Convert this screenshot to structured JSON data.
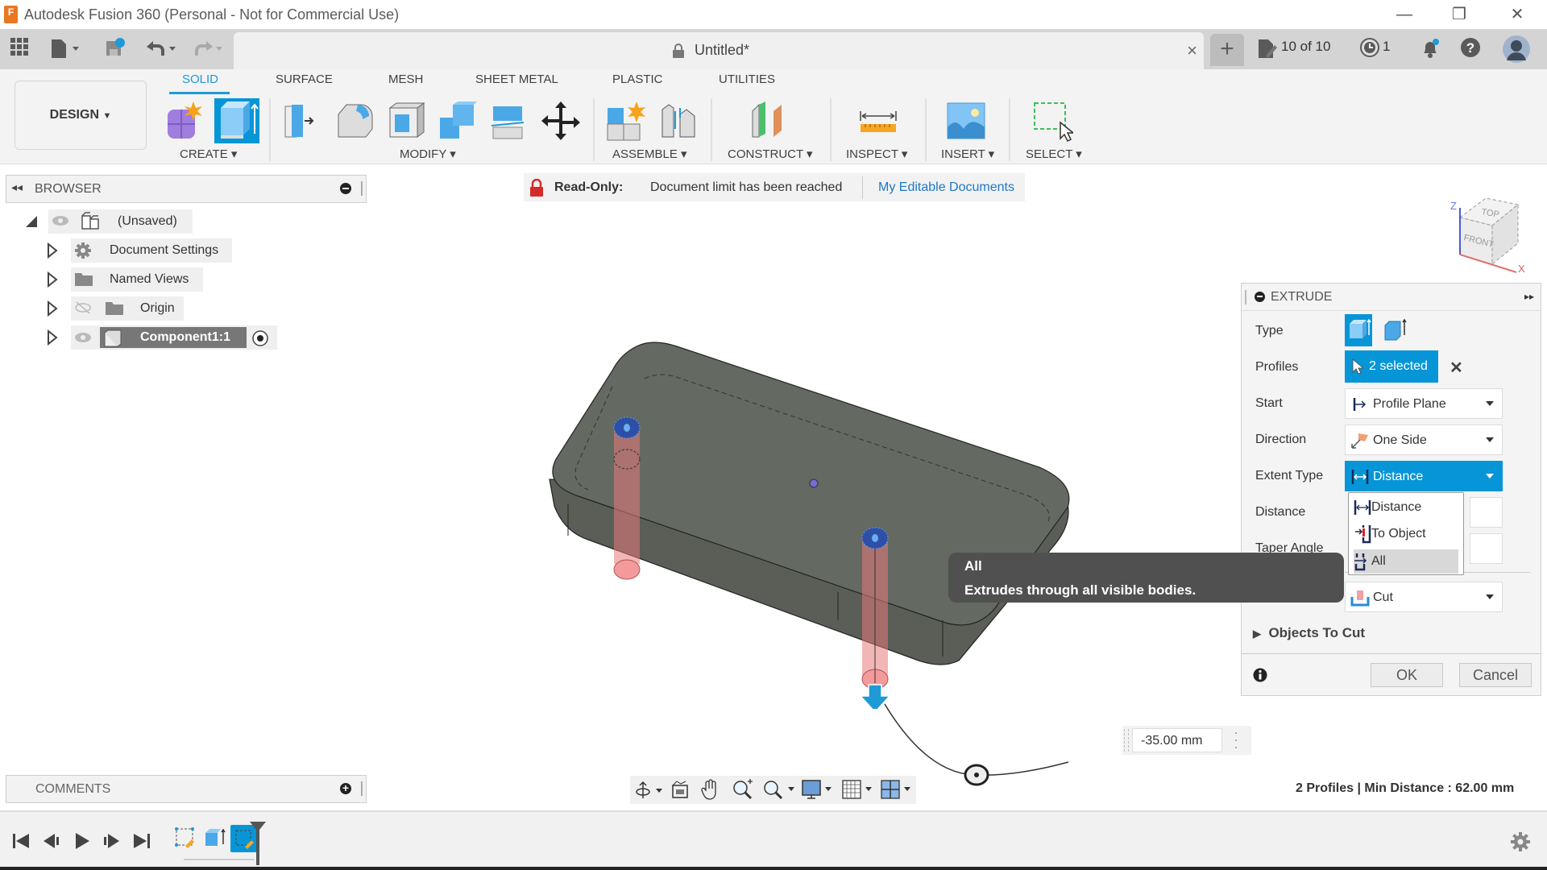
{
  "window": {
    "title": "Autodesk Fusion 360 (Personal - Not for Commercial Use)",
    "app_logo": "F",
    "controls": {
      "minimize": "—",
      "restore": "❐",
      "close": "✕"
    }
  },
  "tabbar": {
    "document_title": "Untitled*",
    "close_tab": "×",
    "new_tab": "+",
    "doc_count": "10 of 10",
    "jobs_count": "1"
  },
  "ribbon": {
    "workspace": "DESIGN",
    "tabs": [
      {
        "label": "SOLID",
        "active": true
      },
      {
        "label": "SURFACE",
        "active": false
      },
      {
        "label": "MESH",
        "active": false
      },
      {
        "label": "SHEET METAL",
        "active": false
      },
      {
        "label": "PLASTIC",
        "active": false
      },
      {
        "label": "UTILITIES",
        "active": false
      }
    ],
    "groups": [
      "CREATE",
      "MODIFY",
      "ASSEMBLE",
      "CONSTRUCT",
      "INSPECT",
      "INSERT",
      "SELECT"
    ]
  },
  "browser": {
    "title": "BROWSER",
    "items": [
      {
        "label": "(Unsaved)",
        "icon": "component-icon"
      },
      {
        "label": "Document Settings",
        "icon": "gear-icon"
      },
      {
        "label": "Named Views",
        "icon": "folder-icon"
      },
      {
        "label": "Origin",
        "icon": "folder-icon"
      },
      {
        "label": "Component1:1",
        "icon": "body-icon"
      }
    ]
  },
  "banner": {
    "label": "Read-Only:",
    "message": "Document limit has been reached",
    "link": "My Editable Documents"
  },
  "viewcube": {
    "top": "TOP",
    "front": "FRONT",
    "z": "Z",
    "x": "X"
  },
  "extrude": {
    "title": "EXTRUDE",
    "rows": {
      "type": "Type",
      "profiles": "Profiles",
      "start": "Start",
      "direction": "Direction",
      "extent_type": "Extent Type",
      "distance": "Distance",
      "taper_angle": "Taper Angle"
    },
    "profiles_value": "2 selected",
    "start_value": "Profile Plane",
    "direction_value": "One Side",
    "extent_value": "Distance",
    "operation_value": "Cut",
    "objects_to_cut": "Objects To Cut",
    "ok": "OK",
    "cancel": "Cancel",
    "extent_options": [
      "Distance",
      "To Object",
      "All"
    ],
    "highlighted_option": "All"
  },
  "tooltip": {
    "title": "All",
    "description": "Extrudes through all visible bodies."
  },
  "distance_input": {
    "value": "-35.00 mm"
  },
  "status": {
    "text": "2 Profiles | Min Distance : 62.00 mm"
  },
  "comments": {
    "title": "COMMENTS"
  },
  "colors": {
    "accent": "#0696d7",
    "active_tab": "#1e9ad6",
    "tooltip_bg": "#505050",
    "body": "#5f655f",
    "cut_preview": "#f08080"
  }
}
